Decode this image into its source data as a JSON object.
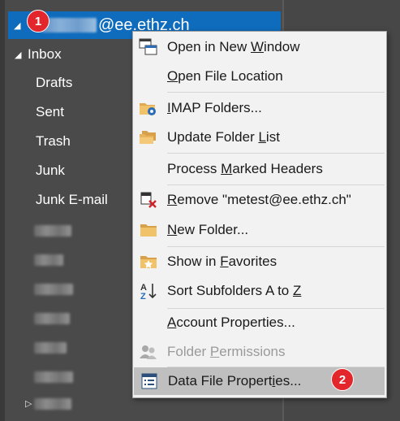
{
  "account": {
    "name_blurred": true,
    "domain_suffix": "@ee.ethz.ch"
  },
  "inbox": {
    "label": "Inbox"
  },
  "folders": [
    "Drafts",
    "Sent",
    "Trash",
    "Junk",
    "Junk E-mail"
  ],
  "badges": {
    "first": "1",
    "second": "2"
  },
  "menu": {
    "items": [
      {
        "pre": "Open in New ",
        "key": "W",
        "post": "indow",
        "icon": "new-window-icon"
      },
      {
        "pre": "",
        "key": "O",
        "post": "pen File Location",
        "icon": ""
      },
      {
        "pre": "",
        "key": "I",
        "post": "MAP Folders...",
        "icon": "imap-folders-icon"
      },
      {
        "pre": "Update Folder ",
        "key": "L",
        "post": "ist",
        "icon": "update-folder-list-icon"
      },
      {
        "pre": "Process ",
        "key": "M",
        "post": "arked Headers",
        "icon": ""
      },
      {
        "pre": "",
        "key": "R",
        "post": "emove \"metest@ee.ethz.ch\"",
        "icon": "remove-account-icon"
      },
      {
        "pre": "",
        "key": "N",
        "post": "ew Folder...",
        "icon": "new-folder-icon"
      },
      {
        "pre": "Show in ",
        "key": "F",
        "post": "avorites",
        "icon": "favorites-icon"
      },
      {
        "pre": "Sort Subfolders A to ",
        "key": "Z",
        "post": "",
        "icon": "sort-a-z-icon"
      },
      {
        "pre": "",
        "key": "A",
        "post": "ccount Properties...",
        "icon": ""
      },
      {
        "pre": "Folder ",
        "key": "P",
        "post": "ermissions",
        "icon": "folder-permissions-icon"
      },
      {
        "pre": "Data File Propert",
        "key": "i",
        "post": "es...",
        "icon": "data-file-properties-icon"
      }
    ]
  },
  "colors": {
    "selection": "#0f6cbd",
    "menu_bg": "#f2f2f2",
    "highlight": "#bfbfbf",
    "badge": "#e3262b"
  }
}
